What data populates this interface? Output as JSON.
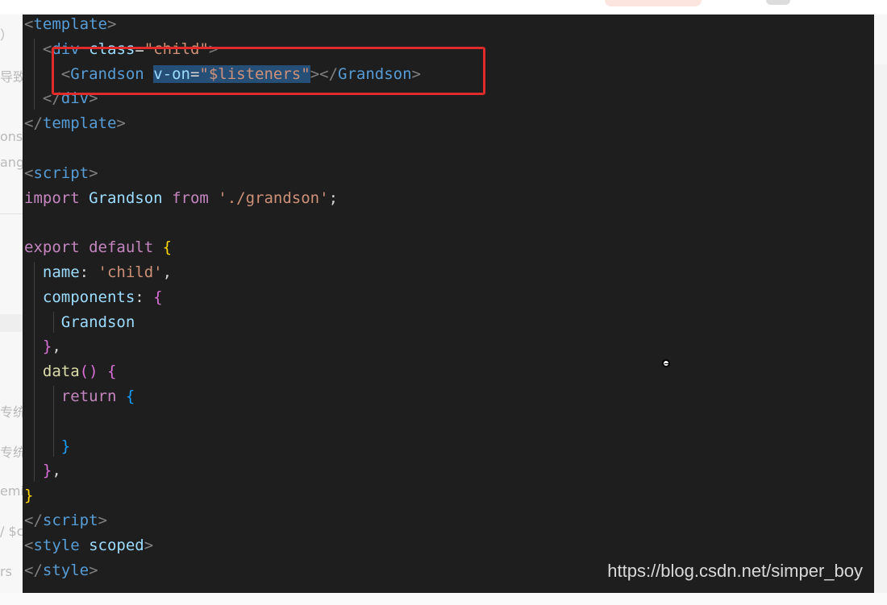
{
  "page": {
    "left_fragments": [
      "）",
      "导致",
      "ons",
      "ang",
      "专统",
      "专统",
      "emi",
      "/ $c",
      "rs"
    ]
  },
  "code": {
    "lines": [
      [
        {
          "t": "<",
          "c": "punc"
        },
        {
          "t": "template",
          "c": "tag"
        },
        {
          "t": ">",
          "c": "punc"
        }
      ],
      [
        {
          "t": "  "
        },
        {
          "t": "<",
          "c": "punc"
        },
        {
          "t": "div",
          "c": "tag"
        },
        {
          "t": " "
        },
        {
          "t": "class",
          "c": "attr"
        },
        {
          "t": "=",
          "c": "plain"
        },
        {
          "t": "\"child\"",
          "c": "str"
        },
        {
          "t": ">",
          "c": "punc"
        }
      ],
      [
        {
          "t": "    "
        },
        {
          "t": "<",
          "c": "punc"
        },
        {
          "t": "Grandson",
          "c": "tag"
        },
        {
          "t": " "
        },
        {
          "t": "v-on",
          "c": "attr",
          "sel": true
        },
        {
          "t": "=",
          "c": "plain",
          "sel": true
        },
        {
          "t": "\"$listeners\"",
          "c": "str",
          "sel": true
        },
        {
          "t": "></",
          "c": "punc"
        },
        {
          "t": "Grandson",
          "c": "tag"
        },
        {
          "t": ">",
          "c": "punc"
        }
      ],
      [
        {
          "t": "  "
        },
        {
          "t": "</",
          "c": "punc"
        },
        {
          "t": "div",
          "c": "tag"
        },
        {
          "t": ">",
          "c": "punc"
        }
      ],
      [
        {
          "t": "</",
          "c": "punc"
        },
        {
          "t": "template",
          "c": "tag"
        },
        {
          "t": ">",
          "c": "punc"
        }
      ],
      [],
      [
        {
          "t": "<",
          "c": "punc"
        },
        {
          "t": "script",
          "c": "tag"
        },
        {
          "t": ">",
          "c": "punc"
        }
      ],
      [
        {
          "t": "import",
          "c": "kw"
        },
        {
          "t": " "
        },
        {
          "t": "Grandson",
          "c": "ident"
        },
        {
          "t": " "
        },
        {
          "t": "from",
          "c": "kw"
        },
        {
          "t": " "
        },
        {
          "t": "'./grandson'",
          "c": "str"
        },
        {
          "t": ";",
          "c": "plain"
        }
      ],
      [],
      [
        {
          "t": "export",
          "c": "kw"
        },
        {
          "t": " "
        },
        {
          "t": "default",
          "c": "kw"
        },
        {
          "t": " "
        },
        {
          "t": "{",
          "c": "brace1"
        }
      ],
      [
        {
          "t": "  "
        },
        {
          "t": "name",
          "c": "ident"
        },
        {
          "t": ": ",
          "c": "plain"
        },
        {
          "t": "'child'",
          "c": "str"
        },
        {
          "t": ",",
          "c": "plain"
        }
      ],
      [
        {
          "t": "  "
        },
        {
          "t": "components",
          "c": "ident"
        },
        {
          "t": ": ",
          "c": "plain"
        },
        {
          "t": "{",
          "c": "brace2"
        }
      ],
      [
        {
          "t": "    "
        },
        {
          "t": "Grandson",
          "c": "ident"
        }
      ],
      [
        {
          "t": "  "
        },
        {
          "t": "}",
          "c": "brace2"
        },
        {
          "t": ",",
          "c": "plain"
        }
      ],
      [
        {
          "t": "  "
        },
        {
          "t": "data",
          "c": "fn"
        },
        {
          "t": "()",
          "c": "brace2"
        },
        {
          "t": " "
        },
        {
          "t": "{",
          "c": "brace2"
        }
      ],
      [
        {
          "t": "    "
        },
        {
          "t": "return",
          "c": "kw"
        },
        {
          "t": " "
        },
        {
          "t": "{",
          "c": "brace3"
        }
      ],
      [],
      [
        {
          "t": "    "
        },
        {
          "t": "}",
          "c": "brace3"
        }
      ],
      [
        {
          "t": "  "
        },
        {
          "t": "}",
          "c": "brace2"
        },
        {
          "t": ",",
          "c": "plain"
        }
      ],
      [
        {
          "t": "}",
          "c": "brace1"
        }
      ],
      [
        {
          "t": "</",
          "c": "punc"
        },
        {
          "t": "script",
          "c": "tag"
        },
        {
          "t": ">",
          "c": "punc"
        }
      ],
      [
        {
          "t": "<",
          "c": "punc"
        },
        {
          "t": "style",
          "c": "tag"
        },
        {
          "t": " "
        },
        {
          "t": "scoped",
          "c": "attr"
        },
        {
          "t": ">",
          "c": "punc"
        }
      ],
      [
        {
          "t": "</",
          "c": "punc"
        },
        {
          "t": "style",
          "c": "tag"
        },
        {
          "t": ">",
          "c": "punc"
        }
      ]
    ]
  },
  "watermark": "https://blog.csdn.net/simper_boy",
  "colors": {
    "editor_bg": "#1e1e1e",
    "highlight_border": "#e12a2a",
    "selection": "#264f78"
  }
}
